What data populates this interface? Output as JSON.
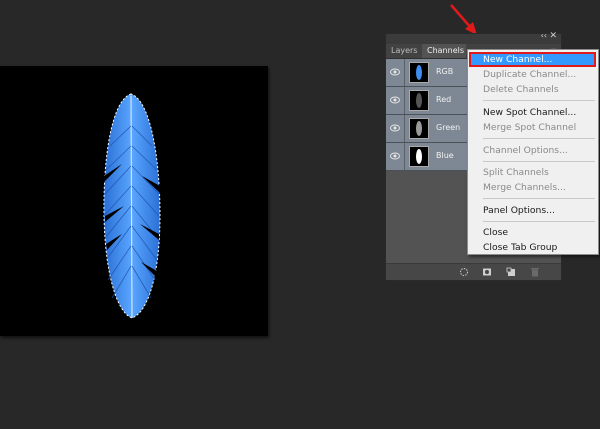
{
  "panel": {
    "tabs": [
      {
        "label": "Layers"
      },
      {
        "label": "Channels"
      }
    ],
    "collapse_glyph": "‹‹",
    "close_glyph": "✕",
    "menu_glyph": "≡",
    "channels": [
      {
        "name": "RGB"
      },
      {
        "name": "Red"
      },
      {
        "name": "Green"
      },
      {
        "name": "Blue"
      }
    ],
    "bottom_icons": [
      "load-selection-icon",
      "save-selection-icon",
      "new-channel-icon",
      "trash-icon"
    ]
  },
  "menu": {
    "items": [
      {
        "label": "New Channel...",
        "enabled": true,
        "highlighted": true
      },
      {
        "label": "Duplicate Channel...",
        "enabled": false
      },
      {
        "label": "Delete Channels",
        "enabled": false
      },
      {
        "label": "New Spot Channel...",
        "enabled": true
      },
      {
        "label": "Merge Spot Channel",
        "enabled": false
      },
      {
        "label": "Channel Options...",
        "enabled": false
      },
      {
        "label": "Split Channels",
        "enabled": false
      },
      {
        "label": "Merge Channels...",
        "enabled": false
      },
      {
        "label": "Panel Options...",
        "enabled": true
      },
      {
        "label": "Close",
        "enabled": true
      },
      {
        "label": "Close Tab Group",
        "enabled": true
      }
    ]
  },
  "colors": {
    "feather": "#3f8df0",
    "highlight": "#3399ff",
    "annotation": "#e01a1a"
  }
}
